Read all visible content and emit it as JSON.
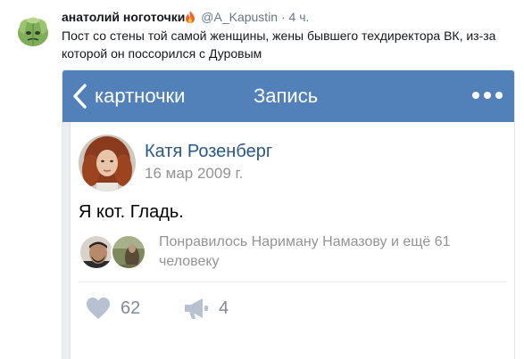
{
  "tweet": {
    "author_name": "анатолий ноготочки",
    "author_icon": "fire-icon",
    "handle": "@A_Kapustin",
    "separator": "·",
    "time": "4 ч.",
    "text": "Пост со стены той самой женщины, жены бывшего техдиректора ВК, из-за которой он поссорился с Дуровым"
  },
  "embed": {
    "bar": {
      "back_label": "картночки",
      "title": "Запись",
      "bar_color": "#5181b8",
      "more_icon": "ellipsis-icon"
    },
    "post": {
      "author": "Катя Розенберг",
      "date": "16 мар 2009 г.",
      "body": "Я кот. Гладь.",
      "likes_summary": "Понравилось Нариману Намазову и ещё 61 человеку",
      "like_count": "62",
      "share_count": "4",
      "link_color": "#2a5885"
    }
  }
}
